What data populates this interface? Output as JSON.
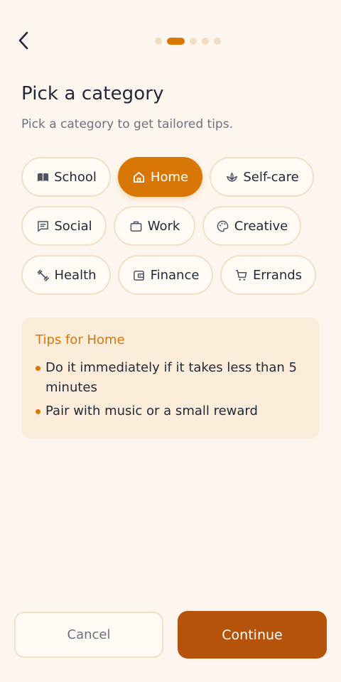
{
  "header": {
    "back_icon": "chevron-left-icon",
    "progress_total": 5,
    "progress_current": 2
  },
  "title": "Pick a category",
  "subtitle": "Pick a category to get tailored tips.",
  "categories": [
    {
      "label": "School",
      "icon": "book-icon",
      "selected": false
    },
    {
      "label": "Home",
      "icon": "home-icon",
      "selected": true
    },
    {
      "label": "Self-care",
      "icon": "lotus-icon",
      "selected": false
    },
    {
      "label": "Social",
      "icon": "message-icon",
      "selected": false
    },
    {
      "label": "Work",
      "icon": "briefcase-icon",
      "selected": false
    },
    {
      "label": "Creative",
      "icon": "palette-icon",
      "selected": false
    },
    {
      "label": "Health",
      "icon": "dumbbell-icon",
      "selected": false
    },
    {
      "label": "Finance",
      "icon": "wallet-icon",
      "selected": false
    },
    {
      "label": "Errands",
      "icon": "cart-icon",
      "selected": false
    }
  ],
  "tips": {
    "title": "Tips for Home",
    "items": [
      "Do it immediately if it takes less than 5 minutes",
      "Pair with music or a small reward"
    ]
  },
  "actions": {
    "cancel_label": "Cancel",
    "continue_label": "Continue"
  },
  "colors": {
    "accent": "#d97706",
    "primary_button": "#b45309",
    "background": "#fdf6ee",
    "tips_background": "#fcecda"
  }
}
